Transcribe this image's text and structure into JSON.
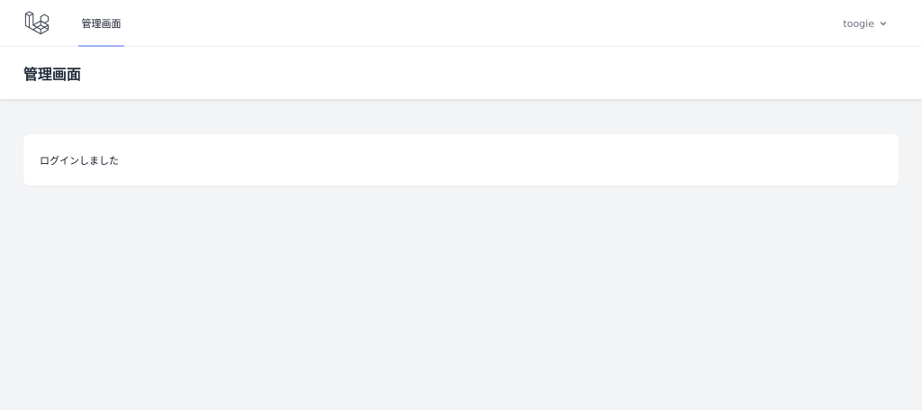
{
  "nav": {
    "logo_icon": "laravel-logo-icon",
    "links": [
      {
        "label": "管理画面",
        "active": true
      }
    ],
    "user": {
      "name": "toogie",
      "dropdown_icon": "chevron-down-icon"
    }
  },
  "header": {
    "title": "管理画面"
  },
  "content": {
    "message": "ログインしました"
  },
  "colors": {
    "background": "#f3f4f6",
    "active_underline": "#a5b4fc",
    "surface": "#ffffff"
  }
}
